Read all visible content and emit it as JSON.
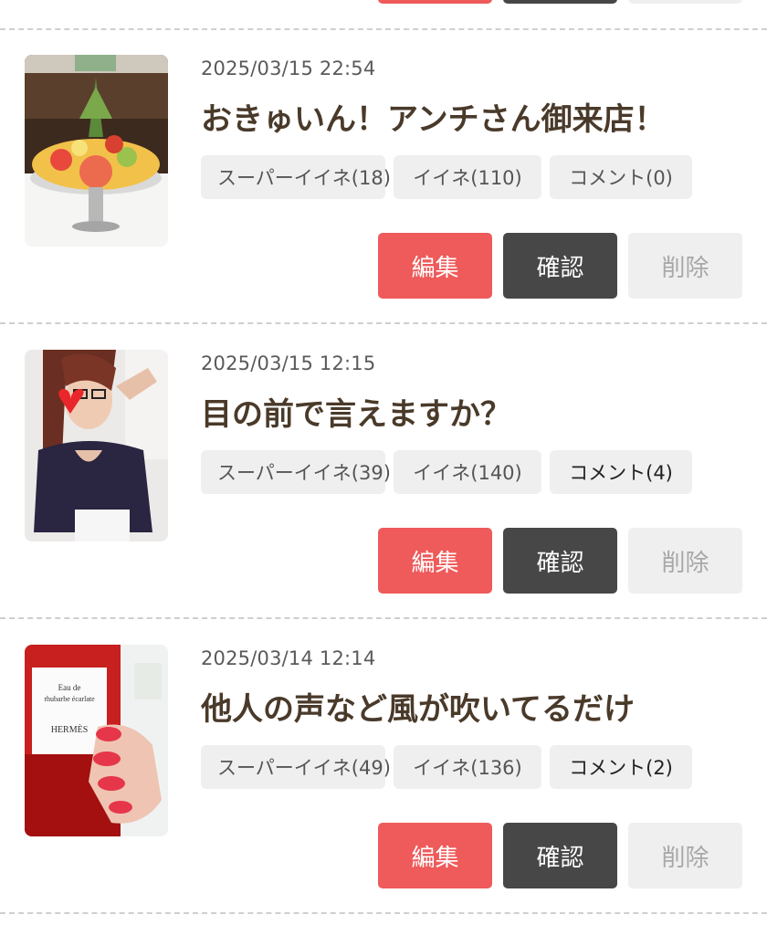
{
  "posts": [
    {
      "date": "2025/03/15 22:54",
      "title": "おきゅいん！アンチさん御来店！",
      "stats": {
        "super_like": "スーパーイイネ(18)",
        "like": "イイネ(110)",
        "comment": "コメント(0)"
      },
      "actions": {
        "edit": "編集",
        "confirm": "確認",
        "delete": "削除"
      },
      "thumbnail": "fruit-platter-image"
    },
    {
      "date": "2025/03/15 12:15",
      "title": "目の前で言えますか？",
      "stats": {
        "super_like": "スーパーイイネ(39)",
        "like": "イイネ(140)",
        "comment": "コメント(4)"
      },
      "actions": {
        "edit": "編集",
        "confirm": "確認",
        "delete": "削除"
      },
      "thumbnail": "selfie-photo-image"
    },
    {
      "date": "2025/03/14 12:14",
      "title": "他人の声など風が吹いてるだけ",
      "stats": {
        "super_like": "スーパーイイネ(49)",
        "like": "イイネ(136)",
        "comment": "コメント(2)"
      },
      "actions": {
        "edit": "編集",
        "confirm": "確認",
        "delete": "削除"
      },
      "thumbnail": "perfume-bottle-image",
      "thumbnail_text": "Eau de rhubarbe écarlate HERMÈS"
    }
  ],
  "colors": {
    "edit": "#ef5a5a",
    "confirm": "#474747",
    "delete": "#efefef",
    "title": "#4a3a2a"
  }
}
